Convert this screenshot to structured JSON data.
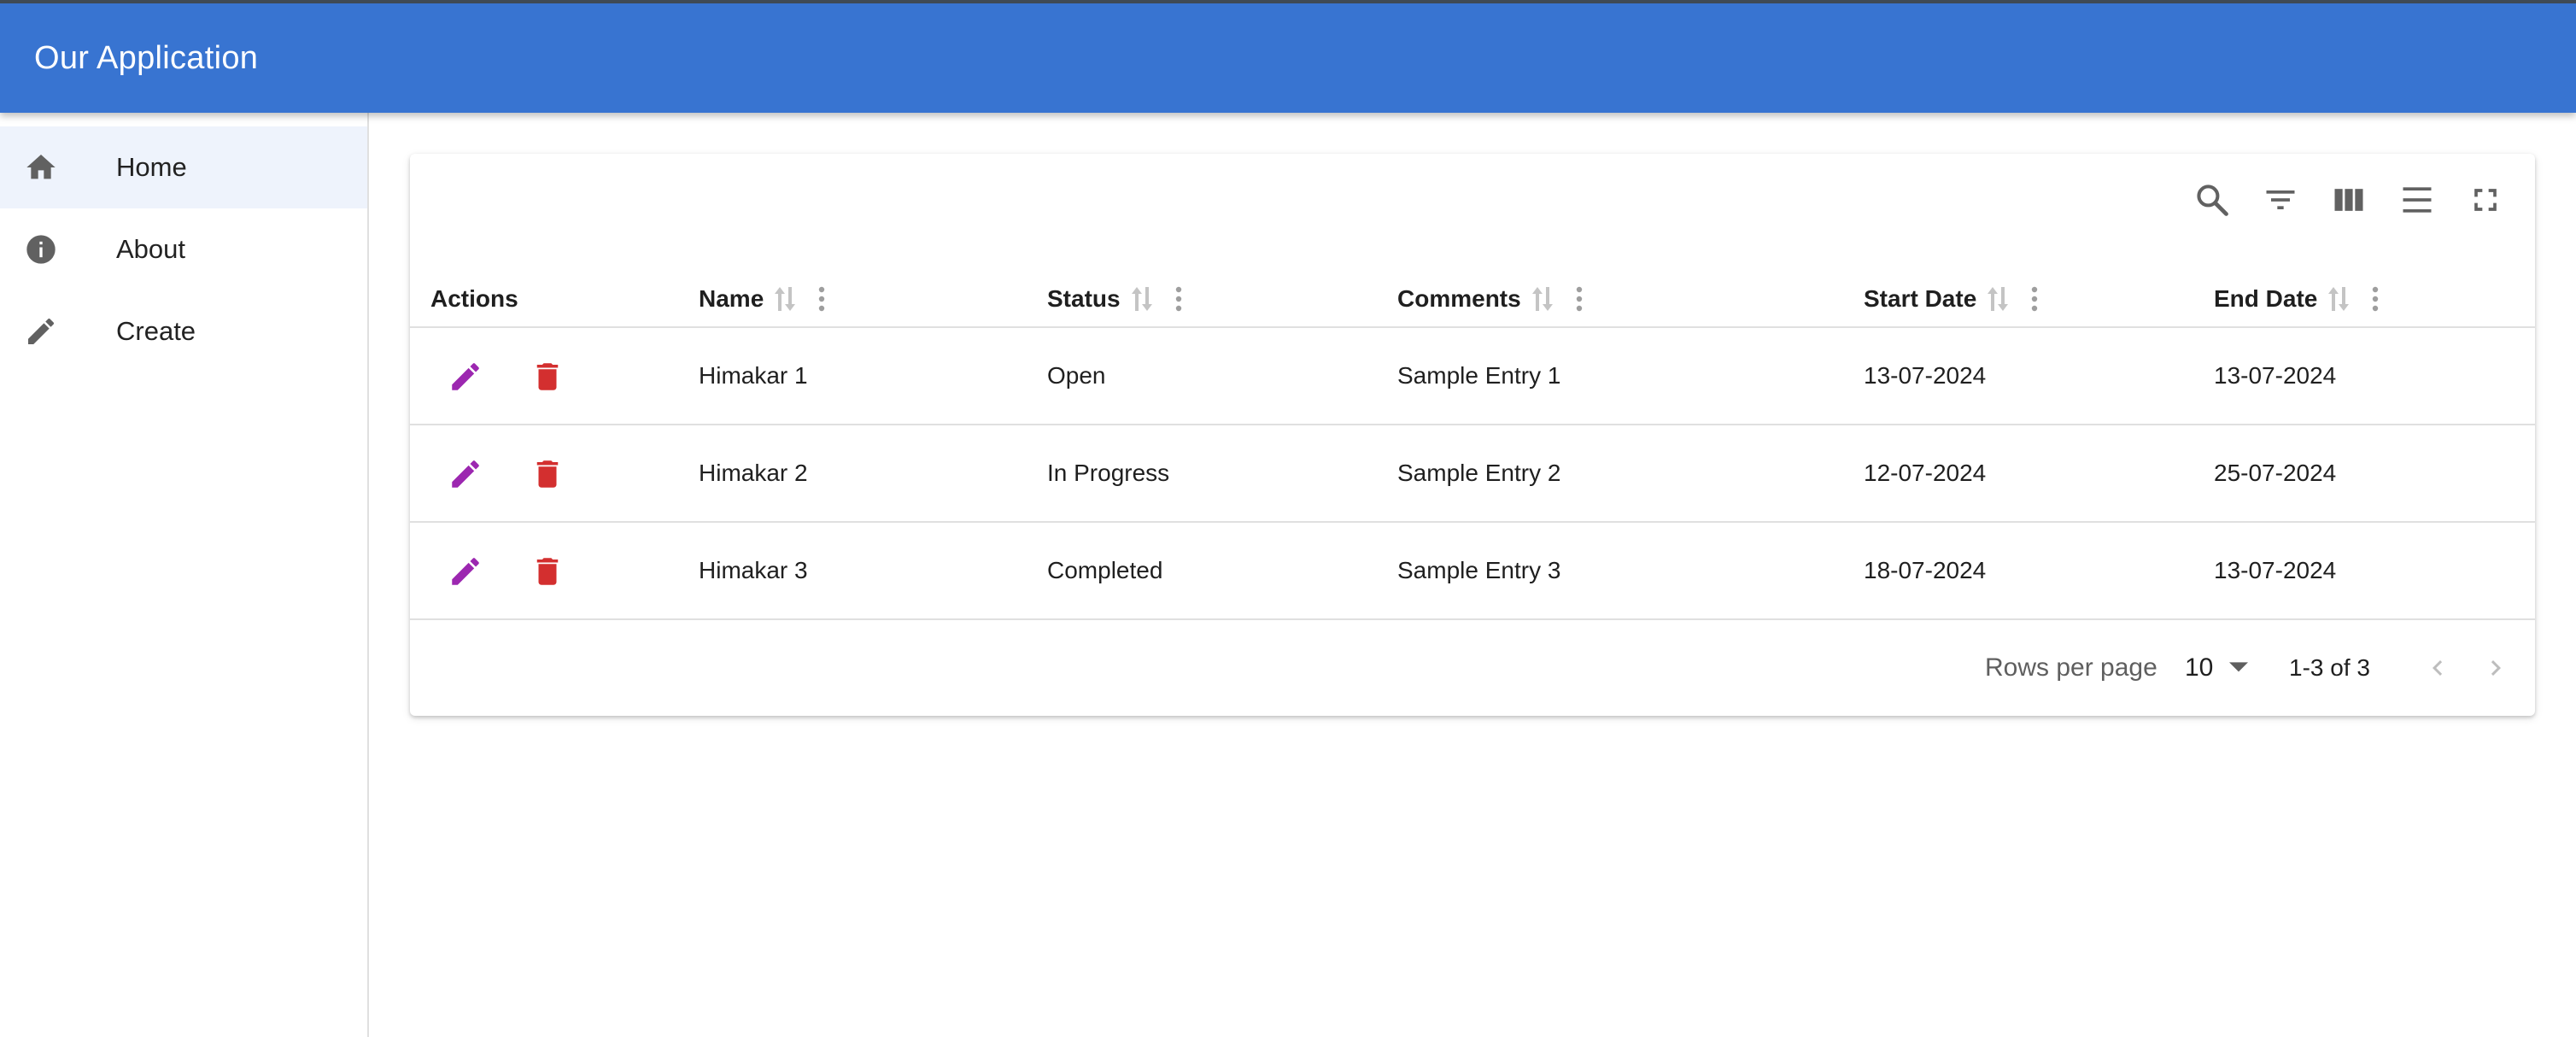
{
  "app": {
    "title": "Our Application"
  },
  "sidebar": {
    "items": [
      {
        "label": "Home",
        "icon": "home-icon"
      },
      {
        "label": "About",
        "icon": "info-icon"
      },
      {
        "label": "Create",
        "icon": "pencil-icon"
      }
    ]
  },
  "toolbar": {
    "icons": [
      "search-icon",
      "filter-icon",
      "columns-icon",
      "density-icon",
      "fullscreen-icon"
    ]
  },
  "table": {
    "columns": [
      "Actions",
      "Name",
      "Status",
      "Comments",
      "Start Date",
      "End Date"
    ],
    "rows": [
      {
        "name": "Himakar 1",
        "status": "Open",
        "comments": "Sample Entry 1",
        "start": "13-07-2024",
        "end": "13-07-2024"
      },
      {
        "name": "Himakar 2",
        "status": "In Progress",
        "comments": "Sample Entry 2",
        "start": "12-07-2024",
        "end": "25-07-2024"
      },
      {
        "name": "Himakar 3",
        "status": "Completed",
        "comments": "Sample Entry 3",
        "start": "18-07-2024",
        "end": "13-07-2024"
      }
    ]
  },
  "pagination": {
    "rows_per_page_label": "Rows per page",
    "rows_per_page": "10",
    "range": "1-3 of 3"
  },
  "colors": {
    "header_bg": "#3874d1",
    "edit_icon": "#9c27b0",
    "delete_icon": "#d32f2f",
    "active_nav": "#eef3fc"
  }
}
